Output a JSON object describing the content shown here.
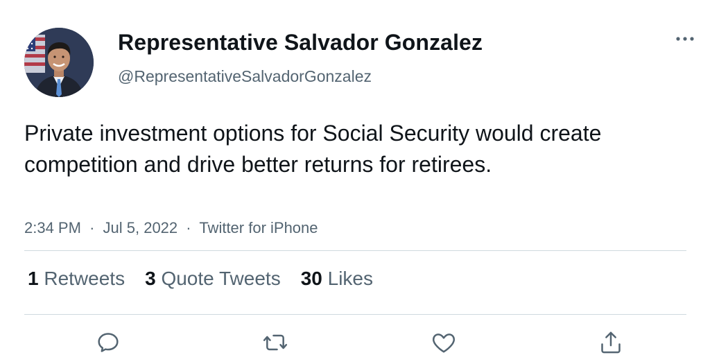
{
  "author": {
    "display_name": "Representative Salvador Gonzalez",
    "handle": "@RepresentativeSalvadorGonzalez",
    "avatar_icon": "profile-photo"
  },
  "tweet": {
    "text": "Private investment options for Social Security would create competition and drive better returns for retirees.",
    "time": "2:34 PM",
    "date": "Jul 5, 2022",
    "source": "Twitter for iPhone",
    "separator": "·"
  },
  "stats": {
    "retweets": {
      "count": "1",
      "label": "Retweets"
    },
    "quote_tweets": {
      "count": "3",
      "label": "Quote Tweets"
    },
    "likes": {
      "count": "30",
      "label": "Likes"
    }
  },
  "actions": [
    {
      "icon": "reply-icon"
    },
    {
      "icon": "retweet-icon"
    },
    {
      "icon": "like-icon"
    },
    {
      "icon": "share-icon"
    }
  ],
  "colors": {
    "text_primary": "#0f1419",
    "text_secondary": "#536471",
    "divider": "#cfd9de",
    "icon": "#536471"
  }
}
